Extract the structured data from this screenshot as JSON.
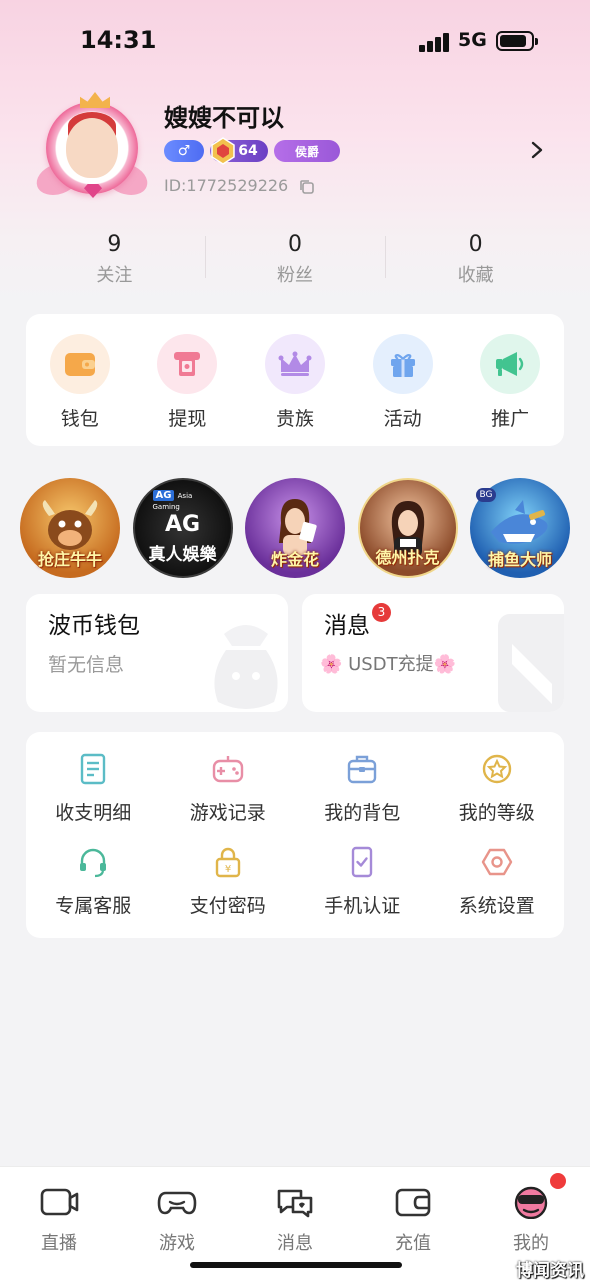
{
  "status_bar": {
    "time": "14:31",
    "network": "5G"
  },
  "profile": {
    "username": "嫂嫂不可以",
    "gender_symbol": "♂",
    "level": "64",
    "noble_badge": "侯爵",
    "user_id": "ID:1772529226"
  },
  "stats": [
    {
      "value": "9",
      "label": "关注"
    },
    {
      "value": "0",
      "label": "粉丝"
    },
    {
      "value": "0",
      "label": "收藏"
    }
  ],
  "quick_actions": [
    {
      "label": "钱包",
      "icon": "wallet-icon",
      "color": "#f5a84a",
      "bg": "#fdeee0"
    },
    {
      "label": "提现",
      "icon": "withdraw-icon",
      "color": "#f07a94",
      "bg": "#fde6ec"
    },
    {
      "label": "贵族",
      "icon": "crown-icon",
      "color": "#b28ae6",
      "bg": "#f1e8fc"
    },
    {
      "label": "活动",
      "icon": "gift-icon",
      "color": "#6fa5ee",
      "bg": "#e4effd"
    },
    {
      "label": "推广",
      "icon": "megaphone-icon",
      "color": "#42c490",
      "bg": "#e0f6ec"
    }
  ],
  "games": [
    {
      "label": "抢庄牛牛",
      "name": "game-qiangzhuang-niuniu"
    },
    {
      "label": "AG真人娛樂",
      "name": "game-ag-live"
    },
    {
      "label": "炸金花",
      "name": "game-zhajinhua"
    },
    {
      "label": "德州扑克",
      "name": "game-texas-poker"
    },
    {
      "label": "捕鱼大师",
      "name": "game-fishing-master"
    }
  ],
  "ag_game": {
    "brand": "AG",
    "sub": "Asia Gaming",
    "title": "AG",
    "subtitle": "真人娛樂"
  },
  "wallet_card": {
    "title": "波币钱包",
    "subtitle": "暂无信息"
  },
  "message_card": {
    "title": "消息",
    "badge": "3",
    "subtitle": "🌸 USDT充提🌸"
  },
  "menu": [
    {
      "label": "收支明细",
      "icon": "receipt-icon",
      "color": "#5bbcc6"
    },
    {
      "label": "游戏记录",
      "icon": "gamepad-icon",
      "color": "#e88ea6"
    },
    {
      "label": "我的背包",
      "icon": "backpack-icon",
      "color": "#7ba0d8"
    },
    {
      "label": "我的等级",
      "icon": "level-star-icon",
      "color": "#e0b54a"
    },
    {
      "label": "专属客服",
      "icon": "headset-icon",
      "color": "#4bb89a"
    },
    {
      "label": "支付密码",
      "icon": "lock-icon",
      "color": "#e0b54a"
    },
    {
      "label": "手机认证",
      "icon": "phone-verify-icon",
      "color": "#a58ad8"
    },
    {
      "label": "系统设置",
      "icon": "settings-icon",
      "color": "#e8948a"
    }
  ],
  "tabbar": [
    {
      "label": "直播",
      "icon": "camera-icon"
    },
    {
      "label": "游戏",
      "icon": "gamepad-tab-icon"
    },
    {
      "label": "消息",
      "icon": "chat-icon"
    },
    {
      "label": "充值",
      "icon": "wallet-tab-icon"
    },
    {
      "label": "我的",
      "icon": "profile-avatar-icon"
    }
  ],
  "watermark": "博闻资讯"
}
